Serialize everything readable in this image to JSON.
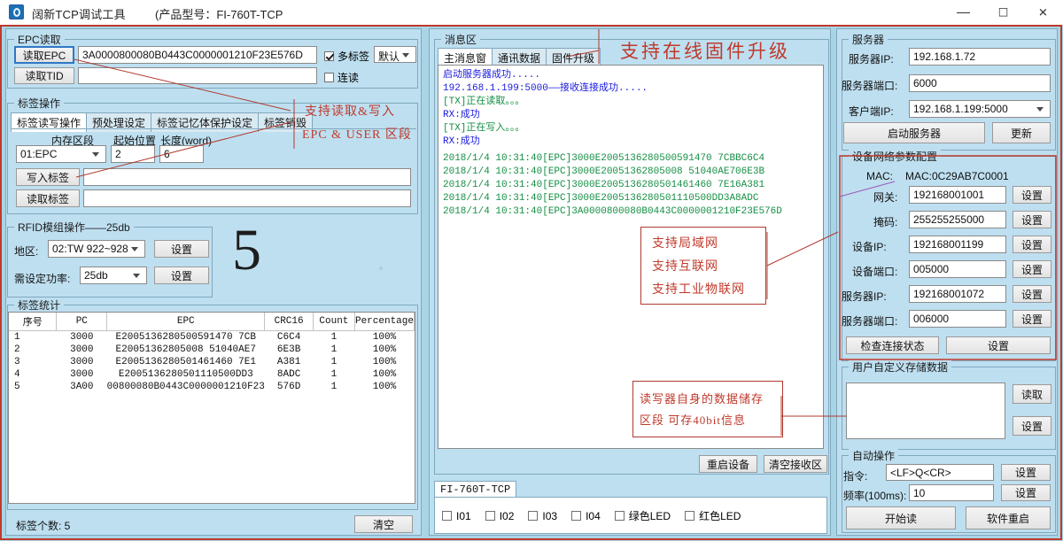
{
  "window": {
    "title": "阔新TCP调试工具",
    "model": "(产品型号：FI-760T-TCP",
    "minimize": "—",
    "maximize": "☐",
    "close": "✕"
  },
  "left": {
    "epc_group": {
      "title": "EPC读取",
      "read_epc_button": "读取EPC",
      "read_tid_button": "读取TID",
      "epc_value": "3A0000800080B0443C0000001210F23E576D",
      "tid_value": "",
      "multi_tag_label": "多标签",
      "multi_tag_checked": true,
      "multi_tag_mode": "默认",
      "continuous_label": "连读",
      "continuous_checked": false
    },
    "tagop_group": {
      "title": "标签操作",
      "tabs": [
        "标签读写操作",
        "预处理设定",
        "标签记忆体保护设定",
        "标签销毁"
      ],
      "active_tab": "标签读写操作",
      "mem_bank_label": "内存区段",
      "start_pos_label": "起始位置",
      "length_label": "长度(word)",
      "mem_bank_value": "01:EPC",
      "start_pos_value": "2",
      "length_value": "6",
      "write_button": "写入标签",
      "read_button": "读取标签",
      "write_value": "",
      "read_value": ""
    },
    "rfid_group": {
      "title": "RFID模组操作——25db",
      "region_label": "地区:",
      "region_value": "02:TW 922~928",
      "region_set_button": "设置",
      "power_label": "需设定功率:",
      "power_value": "25db",
      "power_set_button": "设置"
    },
    "stats_group": {
      "title": "标签统计",
      "columns": [
        "序号",
        "PC",
        "EPC",
        "CRC16",
        "Count",
        "Percentage"
      ],
      "rows": [
        [
          "1",
          "3000",
          "E2005136280500591470 7CB",
          "C6C4",
          "1",
          "100%"
        ],
        [
          "2",
          "3000",
          "E20051362805008 51040AE7",
          "6E3B",
          "1",
          "100%"
        ],
        [
          "3",
          "3000",
          "E2005136280501461460 7E1",
          "A381",
          "1",
          "100%"
        ],
        [
          "4",
          "3000",
          "E2005136280501110500DD3",
          "8ADC",
          "1",
          "100%"
        ],
        [
          "5",
          "3A00",
          "00800080B0443C0000001210F23",
          "576D",
          "1",
          "100%"
        ]
      ]
    },
    "status": {
      "tag_count_label": "标签个数: 5",
      "clear_button": "清空"
    },
    "watermark": "5"
  },
  "middle": {
    "msg_group_title": "消息区",
    "tabs": [
      "主消息窗",
      "通讯数据",
      "固件升级"
    ],
    "active_tab": "主消息窗",
    "log_lines": [
      {
        "text": "启动服务器成功.....",
        "color": "#1a1ae0"
      },
      {
        "text": "192.168.1.199:5000——接收连接成功.....",
        "color": "#1a1ae0"
      },
      {
        "text": "[TX]正在读取。。。",
        "color": "#158f45"
      },
      {
        "text": "RX:成功",
        "color": "#1a1ae0"
      },
      {
        "text": "[TX]正在写入。。。",
        "color": "#158f45"
      },
      {
        "text": "RX:成功",
        "color": "#1a1ae0"
      },
      {
        "text": "2018/1/4 10:31:40[EPC]3000E2005136280500591470 7CBBC6C4",
        "color": "#158f45"
      },
      {
        "text": "2018/1/4 10:31:40[EPC]3000E20051362805008 51040AE706E3B",
        "color": "#158f45"
      },
      {
        "text": "2018/1/4 10:31:40[EPC]3000E2005136280501461460 7E16A381",
        "color": "#158f45"
      },
      {
        "text": "2018/1/4 10:31:40[EPC]3000E2005136280501110500DD3A8ADC",
        "color": "#158f45"
      },
      {
        "text": "2018/1/4 10:31:40[EPC]3A0000800080B0443C0000001210F23E576D",
        "color": "#158f45"
      }
    ],
    "restart_device_button": "重启设备",
    "clear_recv_button": "清空接收区",
    "device_tab": "FI-760T-TCP",
    "io_checkboxes": [
      {
        "label": "I01",
        "checked": false
      },
      {
        "label": "I02",
        "checked": false
      },
      {
        "label": "I03",
        "checked": false
      },
      {
        "label": "I04",
        "checked": false
      },
      {
        "label": "绿色LED",
        "checked": false
      },
      {
        "label": "红色LED",
        "checked": false
      }
    ]
  },
  "right": {
    "server_group": {
      "title": "服务器",
      "server_ip_label": "服务器IP:",
      "server_ip_value": "192.168.1.72",
      "server_port_label": "服务器端口:",
      "server_port_value": "6000",
      "client_ip_label": "客户端IP:",
      "client_ip_value": "192.168.1.199:5000",
      "start_server_button": "启动服务器",
      "refresh_button": "更新"
    },
    "net_group": {
      "title": "设备网络参数配置",
      "mac_label": "MAC:",
      "mac_value": "MAC:0C29AB7C0001",
      "set_button": "设置",
      "fields": [
        {
          "label": "网关:",
          "value": "192168001001"
        },
        {
          "label": "掩码:",
          "value": "255255255000"
        },
        {
          "label": "设备IP:",
          "value": "192168001199"
        },
        {
          "label": "设备端口:",
          "value": "005000"
        },
        {
          "label": "服务器IP:",
          "value": "192168001072"
        },
        {
          "label": "服务器端口:",
          "value": "006000"
        }
      ],
      "check_conn_button": "检查连接状态",
      "bottom_set_button": "设置"
    },
    "user_group": {
      "title": "用户自定义存储数据",
      "value": "",
      "read_button": "读取",
      "set_button": "设置"
    },
    "auto_group": {
      "title": "自动操作",
      "cmd_label": "指令:",
      "cmd_value": "<LF>Q<CR>",
      "cmd_set_button": "设置",
      "freq_label": "频率(100ms):",
      "freq_value": "10",
      "freq_set_button": "设置",
      "start_read_button": "开始读",
      "sw_restart_button": "软件重启"
    }
  },
  "annotations": [
    {
      "id": "firmware",
      "text": "支持在线固件升级"
    },
    {
      "id": "rw1",
      "text": "支持读取&写入"
    },
    {
      "id": "rw2",
      "text": "EPC & USER 区段"
    },
    {
      "id": "net1",
      "text": "支持局域网"
    },
    {
      "id": "net2",
      "text": "支持互联网"
    },
    {
      "id": "net3",
      "text": "支持工业物联网"
    },
    {
      "id": "store1",
      "text": "读写器自身的数据储存"
    },
    {
      "id": "store2",
      "text": "区段 可存40bit信息"
    }
  ],
  "colors": {
    "panel": "#bedff0",
    "window": "#a8d4e6",
    "annotation": "#c0392b",
    "log_green": "#158f45",
    "log_blue": "#1a1ae0"
  }
}
